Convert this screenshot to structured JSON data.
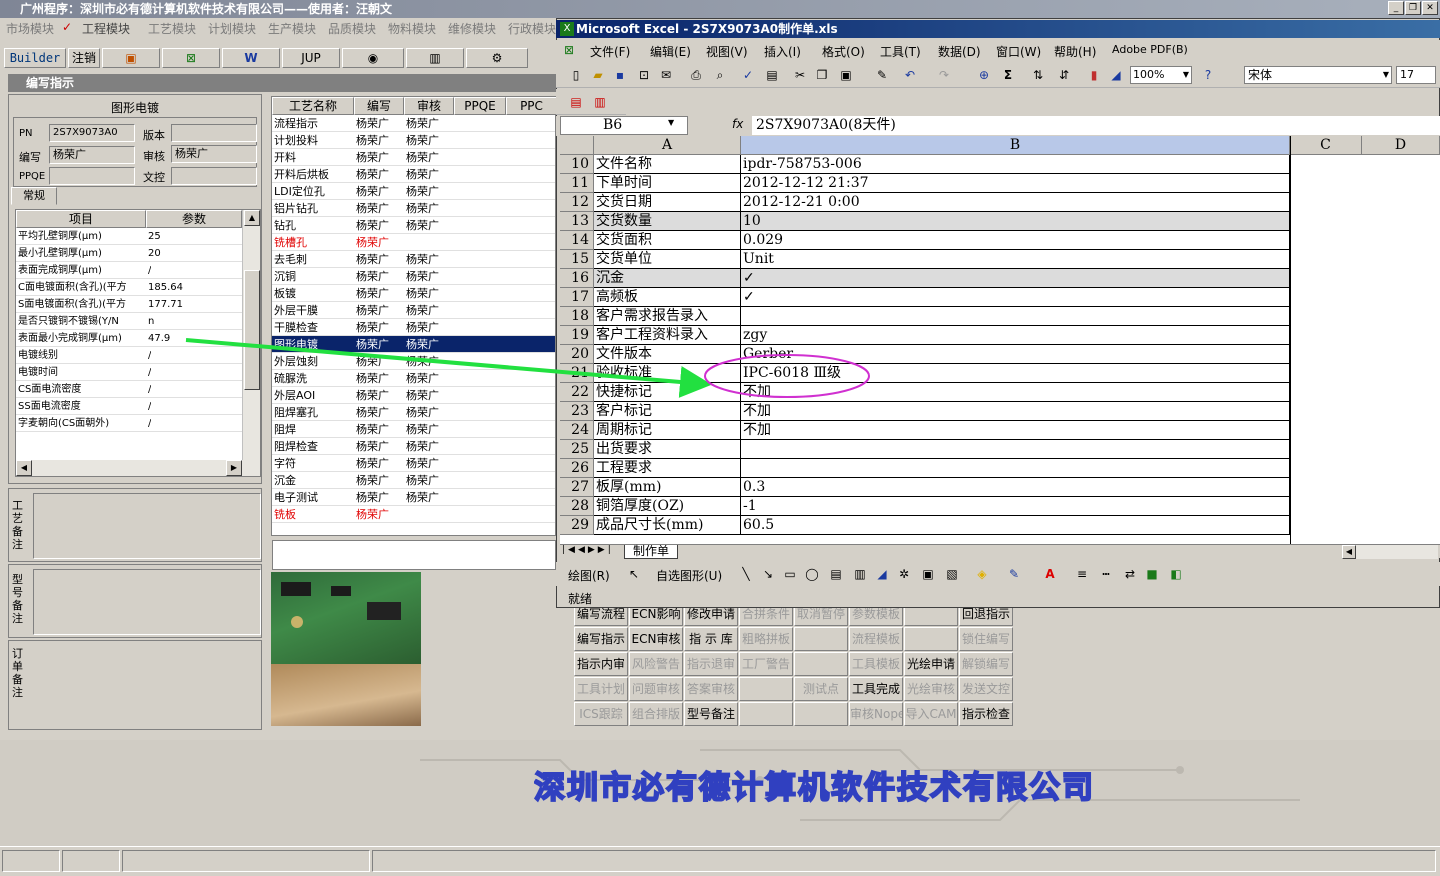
{
  "app": {
    "title": "广州程序：深圳市必有德计算机软件技术有限公司——使用者：汪朝文",
    "modules": [
      "市场模块",
      "工程模块",
      "工艺模块",
      "计划模块",
      "生产模块",
      "品质模块",
      "物料模块",
      "维修模块",
      "行政模块"
    ],
    "toolbar": {
      "builder": "Builder",
      "logout": "注销",
      "jup": "JUP"
    },
    "panel_title": "编写指示",
    "section_title": "图形电镀",
    "fields": {
      "pn_label": "PN",
      "pn_value": "2S7X9073A0",
      "version_label": "版本",
      "writer_label": "编写",
      "writer_value": "杨荣广",
      "reviewer_label": "审核",
      "reviewer_value": "杨荣广",
      "ppqe_label": "PPQE",
      "control_label": "文控"
    },
    "tab_general": "常规",
    "params_headers": [
      "项目",
      "参数"
    ],
    "params": [
      [
        "平均孔壁铜厚(μm)",
        "25"
      ],
      [
        "最小孔壁铜厚(μm)",
        "20"
      ],
      [
        "表面完成铜厚(μm)",
        "/"
      ],
      [
        "C面电镀面积(含孔)(平方",
        "185.64"
      ],
      [
        "S面电镀面积(含孔)(平方",
        "177.71"
      ],
      [
        "是否只镀铜不镀锡(Y/N",
        "n"
      ],
      [
        "表面最小完成铜厚(μm)",
        "47.9"
      ],
      [
        "电镀线别",
        "/"
      ],
      [
        "电镀时间",
        "/"
      ],
      [
        "CS面电流密度",
        "/"
      ],
      [
        "SS面电流密度",
        "/"
      ],
      [
        "字麦朝向(CS面朝外)",
        "/"
      ]
    ],
    "notes": {
      "craft": "工艺备注",
      "model": "型号备注",
      "order": "订单备注"
    },
    "process_headers": [
      "工艺名称",
      "编写",
      "审核",
      "PPQE",
      "PPC"
    ],
    "process": [
      [
        "流程指示",
        "杨荣广",
        "杨荣广",
        ""
      ],
      [
        "计划投料",
        "杨荣广",
        "杨荣广",
        ""
      ],
      [
        "开料",
        "杨荣广",
        "杨荣广",
        ""
      ],
      [
        "开料后烘板",
        "杨荣广",
        "杨荣广",
        ""
      ],
      [
        "LDI定位孔",
        "杨荣广",
        "杨荣广",
        ""
      ],
      [
        "铝片钻孔",
        "杨荣广",
        "杨荣广",
        ""
      ],
      [
        "钻孔",
        "杨荣广",
        "杨荣广",
        ""
      ],
      [
        "铣槽孔",
        "杨荣广",
        "",
        "red"
      ],
      [
        "去毛刺",
        "杨荣广",
        "杨荣广",
        ""
      ],
      [
        "沉铜",
        "杨荣广",
        "杨荣广",
        ""
      ],
      [
        "板镀",
        "杨荣广",
        "杨荣广",
        ""
      ],
      [
        "外层干膜",
        "杨荣广",
        "杨荣广",
        ""
      ],
      [
        "干膜检查",
        "杨荣广",
        "杨荣广",
        ""
      ],
      [
        "图形电镀",
        "杨荣广",
        "杨荣广",
        "sel"
      ],
      [
        "外层蚀刻",
        "杨荣广",
        "杨荣广",
        ""
      ],
      [
        "硫脲洗",
        "杨荣广",
        "杨荣广",
        ""
      ],
      [
        "外层AOI",
        "杨荣广",
        "杨荣广",
        ""
      ],
      [
        "阻焊塞孔",
        "杨荣广",
        "杨荣广",
        ""
      ],
      [
        "阻焊",
        "杨荣广",
        "杨荣广",
        ""
      ],
      [
        "阻焊检查",
        "杨荣广",
        "杨荣广",
        ""
      ],
      [
        "字符",
        "杨荣广",
        "杨荣广",
        ""
      ],
      [
        "沉金",
        "杨荣广",
        "杨荣广",
        ""
      ],
      [
        "电子测试",
        "杨荣广",
        "杨荣广",
        ""
      ],
      [
        "铣板",
        "杨荣广",
        "",
        "red"
      ]
    ],
    "buttons": [
      [
        "编写流程",
        "ECN影响",
        "修改申请",
        "合拼条件",
        "取消暂停",
        "参数模板",
        "",
        "回退指示"
      ],
      [
        "编写指示",
        "ECN审核",
        "指 示 库",
        "粗略拼板",
        "",
        "流程模板",
        "",
        "锁住编写"
      ],
      [
        "指示内审",
        "风险警告",
        "指示退审",
        "工厂警告",
        "",
        "工具模板",
        "光绘申请",
        "解锁编写"
      ],
      [
        "工具计划",
        "问题审核",
        "答案审核",
        "",
        "测试点",
        "工具完成",
        "光绘审核",
        "发送文控"
      ],
      [
        "ICS跟踪",
        "组合排版",
        "型号备注",
        "",
        "",
        "审核Nope",
        "导入CAM",
        "指示检查"
      ]
    ],
    "buttons_disabled": [
      [
        false,
        false,
        false,
        true,
        true,
        true,
        false,
        false
      ],
      [
        false,
        false,
        false,
        true,
        false,
        true,
        false,
        true
      ],
      [
        false,
        true,
        true,
        true,
        false,
        true,
        false,
        true
      ],
      [
        true,
        true,
        true,
        false,
        true,
        false,
        true,
        true
      ],
      [
        true,
        true,
        false,
        false,
        false,
        true,
        true,
        false
      ]
    ],
    "company": "深圳市必有德计算机软件技术有限公司"
  },
  "excel": {
    "title": "Microsoft Excel - 2S7X9073A0制作单.xls",
    "menu": [
      "文件(F)",
      "编辑(E)",
      "视图(V)",
      "插入(I)",
      "格式(O)",
      "工具(T)",
      "数据(D)",
      "窗口(W)",
      "帮助(H)",
      "Adobe PDF(B)"
    ],
    "zoom": "100%",
    "font_name": "宋体",
    "font_size": "17",
    "name_box": "B6",
    "formula": "2S7X9073A0(8天件)",
    "cols": [
      "A",
      "B",
      "C",
      "D"
    ],
    "rows": [
      [
        "10",
        "文件名称",
        "ipdr-758753-006"
      ],
      [
        "11",
        "下单时间",
        "2012-12-12 21:37"
      ],
      [
        "12",
        "交货日期",
        "2012-12-21 0:00"
      ],
      [
        "13",
        "交货数量",
        "10"
      ],
      [
        "14",
        "交货面积",
        "0.029"
      ],
      [
        "15",
        "交货单位",
        "Unit"
      ],
      [
        "16",
        "沉金",
        "✓"
      ],
      [
        "17",
        "高频板",
        "✓"
      ],
      [
        "18",
        "客户需求报告录入",
        ""
      ],
      [
        "19",
        "客户工程资料录入",
        "zgy"
      ],
      [
        "20",
        "文件版本",
        "Gerber"
      ],
      [
        "21",
        "验收标准",
        "IPC-6018 Ⅲ级"
      ],
      [
        "22",
        "快捷标记",
        "不加"
      ],
      [
        "23",
        "客户标记",
        "不加"
      ],
      [
        "24",
        "周期标记",
        "不加"
      ],
      [
        "25",
        "出货要求",
        ""
      ],
      [
        "26",
        "工程要求",
        ""
      ],
      [
        "27",
        "板厚(mm)",
        "0.3"
      ],
      [
        "28",
        "铜箔厚度(OZ)",
        "-1"
      ],
      [
        "29",
        "成品尺寸长(mm)",
        "60.5"
      ]
    ],
    "shaded_rows": [
      "13",
      "16"
    ],
    "sheet_tab": "制作单",
    "draw_label": "绘图(R)",
    "autoshape_label": "自选图形(U)",
    "status": "就绪"
  }
}
